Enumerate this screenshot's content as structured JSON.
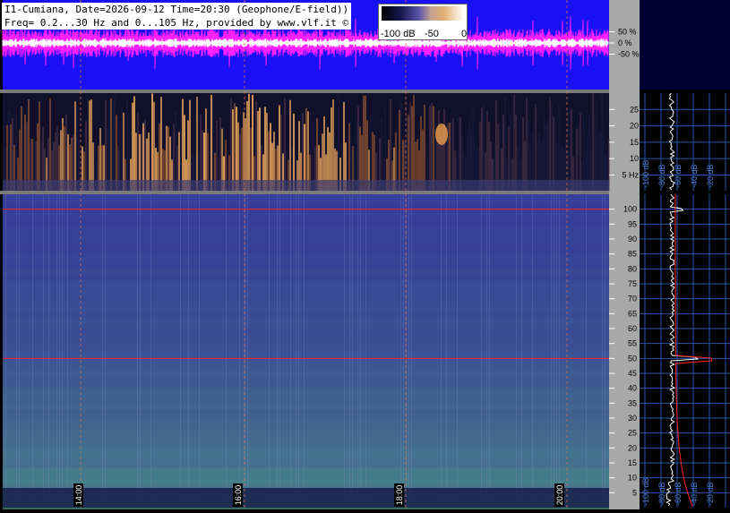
{
  "header": {
    "line1": "I1-Cumiana, Date=2026-09-12 Time=20:30 (Geophone/E-field))",
    "line2": "Freq= 0.2...30 Hz and 0...105 Hz, provided by www.vlf.it ©"
  },
  "colorbar": {
    "labels": [
      "-100 dB",
      "-50",
      "0"
    ]
  },
  "chart_data": [
    {
      "type": "line",
      "name": "waveform",
      "ylabels": [
        "50 %",
        "0 %",
        "-50 %"
      ],
      "yticks": [
        50,
        0,
        -50
      ],
      "ylim": [
        -100,
        100
      ],
      "colors": {
        "background": "#1a10f5",
        "trace": "#ff20ff",
        "trace_core": "#ffffff"
      }
    },
    {
      "type": "heatmap",
      "name": "low-frequency-spectrogram",
      "yticks": [
        5,
        10,
        15,
        20,
        25
      ],
      "ytick_labels": [
        "5 Hz",
        "10",
        "15",
        "20",
        "25"
      ],
      "ylim": [
        0.2,
        30
      ],
      "colors": {
        "background": "#10102a",
        "hot": "#e8a050"
      }
    },
    {
      "type": "heatmap",
      "name": "high-frequency-spectrogram",
      "yticks": [
        5,
        10,
        15,
        20,
        25,
        30,
        35,
        40,
        45,
        50,
        55,
        60,
        65,
        70,
        75,
        80,
        85,
        90,
        95,
        100
      ],
      "ylim": [
        0,
        105
      ],
      "markers": [
        50,
        100
      ],
      "time_ticks": [
        "14:00",
        "16:00",
        "18:00",
        "20:00"
      ],
      "colors": {
        "background": "#3a3a9a",
        "marker_line": "#ff2020",
        "time_line": "#d07050"
      }
    }
  ],
  "side_profiles": {
    "labels_low": [
      "-100 dB",
      "-80 dB",
      "-60 dB",
      "-40 dB",
      "-20 dB"
    ],
    "labels_high": [
      "-100 dB",
      "-80 dB",
      "-60 dB",
      "-40 dB",
      "-20 dB"
    ],
    "colors": {
      "background": "#000000",
      "grid": "#2a55aa",
      "trace": "#ffffff",
      "model": "#ff2020"
    }
  }
}
